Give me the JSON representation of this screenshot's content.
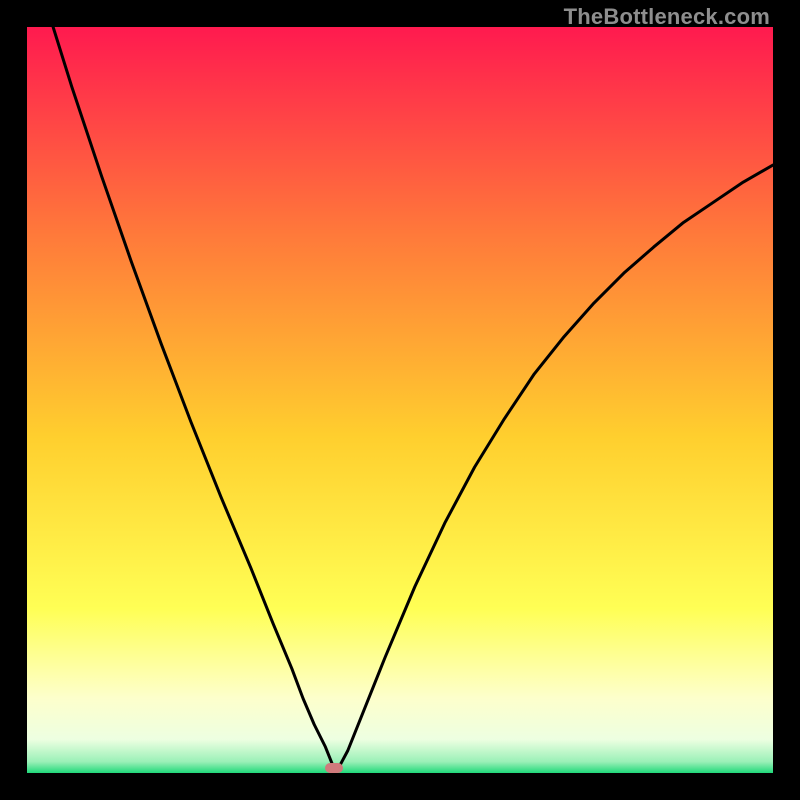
{
  "watermark": "TheBottleneck.com",
  "colors": {
    "frame": "#000000",
    "gradient_top": "#ff1a4f",
    "gradient_mid_upper": "#ff7a3a",
    "gradient_mid": "#ffcf2e",
    "gradient_mid_lower": "#ffff55",
    "gradient_pale": "#fdffcc",
    "gradient_bottom": "#1fd97a",
    "curve": "#000000",
    "marker": "#cf7a7c"
  },
  "chart_data": {
    "type": "line",
    "title": "",
    "xlabel": "",
    "ylabel": "",
    "xlim": [
      0,
      100
    ],
    "ylim": [
      0,
      100
    ],
    "series": [
      {
        "name": "bottleneck-curve",
        "x": [
          3.5,
          6,
          10,
          14,
          18,
          22,
          26,
          30,
          33,
          35.5,
          37,
          38.5,
          40,
          41.4,
          43,
          45,
          48,
          52,
          56,
          60,
          64,
          68,
          72,
          76,
          80,
          84,
          88,
          92,
          96,
          100
        ],
        "values": [
          100,
          92,
          80,
          68.5,
          57.5,
          47,
          37,
          27.5,
          20,
          14,
          10,
          6.5,
          3.5,
          0,
          3,
          8,
          15.5,
          25,
          33.5,
          41,
          47.5,
          53.5,
          58.5,
          63,
          67,
          70.5,
          73.8,
          76.5,
          79.2,
          81.5
        ]
      }
    ],
    "marker": {
      "x": 41.2,
      "y": 0,
      "width_pct": 2.4,
      "height_pct": 1.3
    },
    "gradient_stops": [
      {
        "pos": 0.0,
        "color": "#ff1a4f"
      },
      {
        "pos": 0.28,
        "color": "#ff7a3a"
      },
      {
        "pos": 0.55,
        "color": "#ffcf2e"
      },
      {
        "pos": 0.78,
        "color": "#ffff55"
      },
      {
        "pos": 0.9,
        "color": "#fdffcc"
      },
      {
        "pos": 0.955,
        "color": "#edffe1"
      },
      {
        "pos": 0.985,
        "color": "#9af0b7"
      },
      {
        "pos": 1.0,
        "color": "#1fd97a"
      }
    ]
  }
}
